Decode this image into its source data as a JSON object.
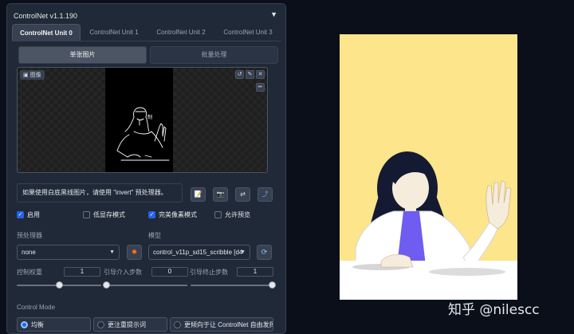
{
  "panel": {
    "title": "ControlNet v1.1.190",
    "collapse_icon": "▼",
    "tabs": [
      {
        "label": "ControlNet Unit 0",
        "active": true
      },
      {
        "label": "ControlNet Unit 1",
        "active": false
      },
      {
        "label": "ControlNet Unit 2",
        "active": false
      },
      {
        "label": "ControlNet Unit 3",
        "active": false
      }
    ],
    "subtabs": [
      {
        "label": "单张图片",
        "active": true
      },
      {
        "label": "批量处理",
        "active": false
      }
    ],
    "image": {
      "label": "图像",
      "tools": [
        "refresh-icon",
        "edit-icon",
        "close-icon",
        "pencil-icon"
      ]
    },
    "hint": "如果使用白底黑线图片，请使用 \"invert\" 预处理器。",
    "hint_buttons": [
      "new-canvas-icon",
      "camera-icon",
      "swap-icon",
      "send-icon"
    ],
    "checkboxes": [
      {
        "label": "启用",
        "checked": true
      },
      {
        "label": "低显存模式",
        "checked": false
      },
      {
        "label": "完美像素模式",
        "checked": true
      },
      {
        "label": "允许预览",
        "checked": false
      }
    ],
    "preprocessor": {
      "label": "预处理器",
      "value": "none"
    },
    "model": {
      "label": "模型",
      "value": "control_v11p_sd15_scribble [d4"
    },
    "control_weight": {
      "label": "控制权重",
      "value": "1",
      "fraction": 0.5
    },
    "start_step": {
      "label": "引导介入步数",
      "value": "0",
      "fraction": 0.0
    },
    "end_step": {
      "label": "引导终止步数",
      "value": "1",
      "fraction": 1.0
    },
    "control_mode": {
      "label": "Control Mode",
      "options": [
        {
          "label": "均衡",
          "selected": true
        },
        {
          "label": "更注重提示词",
          "selected": false
        },
        {
          "label": "更倾向于让 ControlNet 自由发挥",
          "selected": false
        }
      ]
    }
  },
  "watermark": "知乎 @nilescc",
  "colors": {
    "accent": "#2563eb",
    "panel_bg": "#1f2937",
    "page_bg": "#0b0f19",
    "preview_bg": "#fce58a"
  }
}
